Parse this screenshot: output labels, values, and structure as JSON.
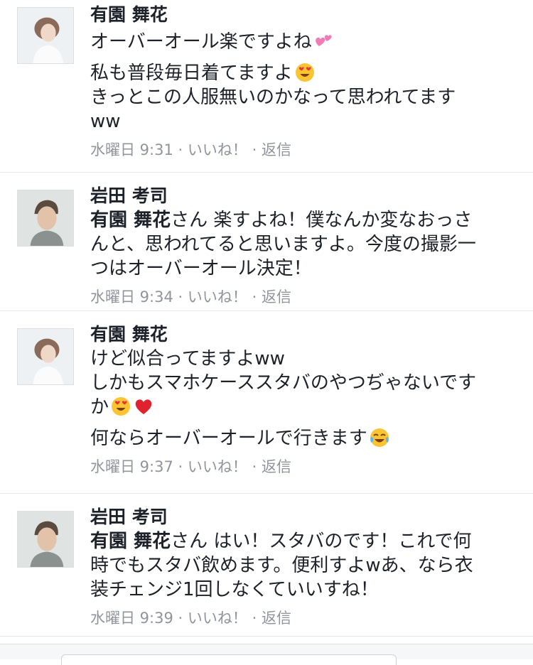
{
  "comments": [
    {
      "author": "有園 舞花",
      "paragraphs": [
        {
          "lines": [
            {
              "text": "オーバーオール楽ですよね",
              "emoji": [
                "two-hearts"
              ]
            }
          ]
        },
        {
          "lines": [
            {
              "text": "私も普段毎日着てますよ",
              "emoji": [
                "heart-eyes"
              ]
            },
            {
              "text": "きっとこの人服無いのかなって思われてます"
            },
            {
              "text": "ww"
            }
          ]
        }
      ],
      "time": "水曜日 9:31",
      "like": "いいね！",
      "reply": "返信"
    },
    {
      "author": "岩田 考司",
      "mention": "有園 舞花",
      "lines": [
        {
          "text": "さん 楽すよね！僕なんか変なおっさ"
        },
        {
          "text": "んと、思われてると思いますよ。今度の撮影一"
        },
        {
          "text": "つはオーバーオール決定！"
        }
      ],
      "time": "水曜日 9:34",
      "like": "いいね！",
      "reply": "返信"
    },
    {
      "author": "有園 舞花",
      "paragraphs": [
        {
          "lines": [
            {
              "text": "けど似合ってますよww"
            },
            {
              "text": "しかもスマホケーススタバのやつぢゃないです"
            },
            {
              "text": "か",
              "emoji": [
                "heart-eyes",
                "red-heart"
              ]
            }
          ]
        },
        {
          "lines": [
            {
              "text": "何ならオーバーオールで行きます",
              "emoji": [
                "tears-of-joy"
              ]
            }
          ]
        }
      ],
      "time": "水曜日 9:37",
      "like": "いいね！",
      "reply": "返信"
    },
    {
      "author": "岩田 考司",
      "mention": "有園 舞花",
      "lines": [
        {
          "text": "さん はい！スタバのです！これで何"
        },
        {
          "text": "時でもスタバ飲めます。便利すよwあ、なら衣"
        },
        {
          "text": "装チェンジ1回しなくていいすね！"
        }
      ],
      "time": "水曜日 9:39",
      "like": "いいね！",
      "reply": "返信"
    }
  ],
  "separator": "·",
  "colors": {
    "text": "#1d2129",
    "meta": "#90949c",
    "divider": "#e5e6e9"
  }
}
